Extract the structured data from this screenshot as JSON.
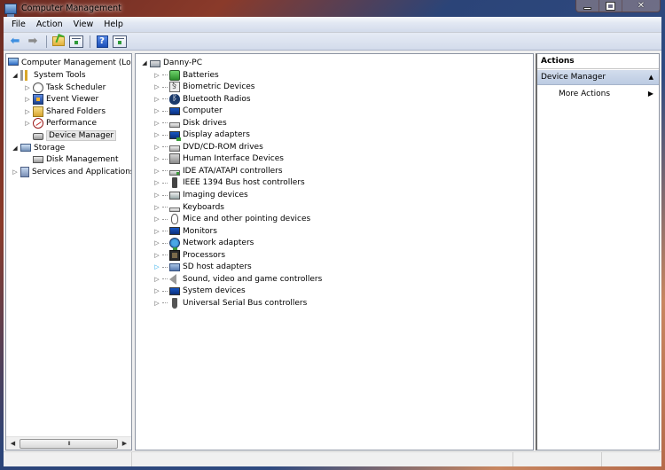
{
  "window": {
    "title": "Computer Management",
    "caption_buttons": [
      "minimize",
      "maximize",
      "close"
    ]
  },
  "menu": [
    "File",
    "Action",
    "View",
    "Help"
  ],
  "toolbar": {
    "buttons": [
      "back",
      "forward",
      "up-one-level",
      "show-hide-console-tree",
      "help",
      "show-hide-action-pane"
    ]
  },
  "left_tree": {
    "root": "Computer Management (Local",
    "items": [
      {
        "label": "System Tools",
        "level": 1,
        "expander": "open",
        "icon": "tools-icon"
      },
      {
        "label": "Task Scheduler",
        "level": 2,
        "expander": "closed",
        "icon": "clock-icon"
      },
      {
        "label": "Event Viewer",
        "level": 2,
        "expander": "closed",
        "icon": "event-viewer-icon"
      },
      {
        "label": "Shared Folders",
        "level": 2,
        "expander": "closed",
        "icon": "shared-folders-icon"
      },
      {
        "label": "Performance",
        "level": 2,
        "expander": "closed",
        "icon": "performance-icon"
      },
      {
        "label": "Device Manager",
        "level": 2,
        "expander": "none",
        "icon": "device-manager-icon",
        "selected": true
      },
      {
        "label": "Storage",
        "level": 1,
        "expander": "open",
        "icon": "storage-icon"
      },
      {
        "label": "Disk Management",
        "level": 2,
        "expander": "none",
        "icon": "disk-icon"
      },
      {
        "label": "Services and Applications",
        "level": 1,
        "expander": "closed",
        "icon": "services-icon"
      }
    ],
    "scrollbar_thumb": "III"
  },
  "device_tree": {
    "root": "Danny-PC",
    "categories": [
      {
        "label": "Batteries",
        "icon": "battery-icon"
      },
      {
        "label": "Biometric Devices",
        "icon": "biometric-icon"
      },
      {
        "label": "Bluetooth Radios",
        "icon": "bluetooth-icon"
      },
      {
        "label": "Computer",
        "icon": "computer-icon"
      },
      {
        "label": "Disk drives",
        "icon": "disk-drive-icon"
      },
      {
        "label": "Display adapters",
        "icon": "display-adapter-icon"
      },
      {
        "label": "DVD/CD-ROM drives",
        "icon": "dvd-icon"
      },
      {
        "label": "Human Interface Devices",
        "icon": "hid-icon"
      },
      {
        "label": "IDE ATA/ATAPI controllers",
        "icon": "ide-icon"
      },
      {
        "label": "IEEE 1394 Bus host controllers",
        "icon": "ieee1394-icon"
      },
      {
        "label": "Imaging devices",
        "icon": "imaging-icon"
      },
      {
        "label": "Keyboards",
        "icon": "keyboard-icon"
      },
      {
        "label": "Mice and other pointing devices",
        "icon": "mouse-icon"
      },
      {
        "label": "Monitors",
        "icon": "monitor-icon"
      },
      {
        "label": "Network adapters",
        "icon": "network-icon"
      },
      {
        "label": "Processors",
        "icon": "processor-icon"
      },
      {
        "label": "SD host adapters",
        "icon": "sd-icon",
        "hover": true
      },
      {
        "label": "Sound, video and game controllers",
        "icon": "sound-icon"
      },
      {
        "label": "System devices",
        "icon": "system-icon"
      },
      {
        "label": "Universal Serial Bus controllers",
        "icon": "usb-icon"
      }
    ]
  },
  "actions_pane": {
    "header": "Actions",
    "section": "Device Manager",
    "items": [
      "More Actions"
    ]
  }
}
